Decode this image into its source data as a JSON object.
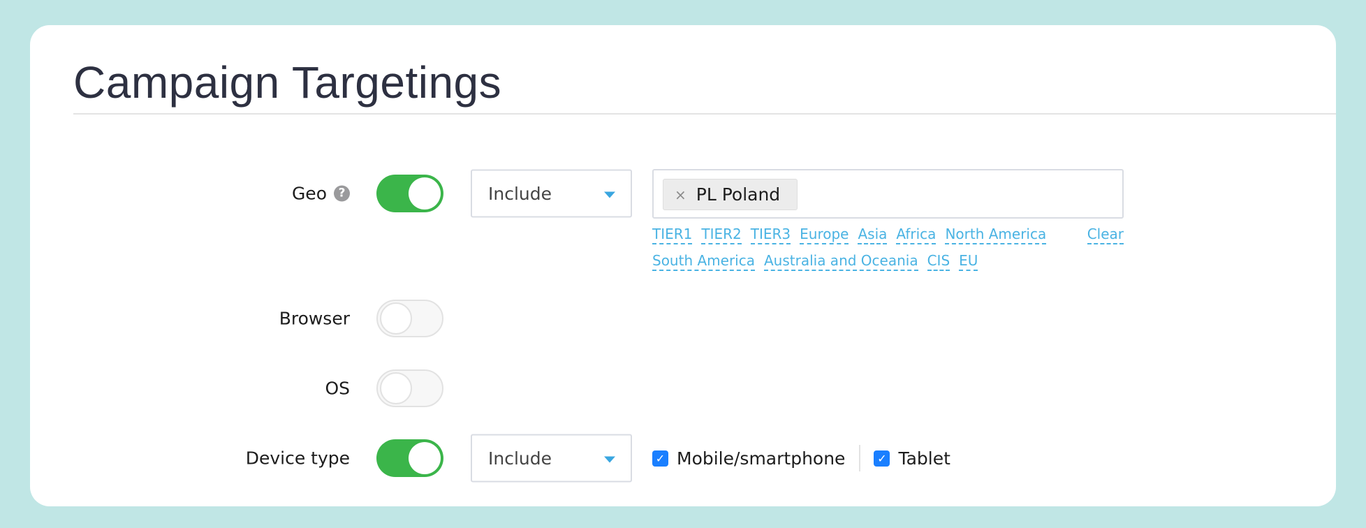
{
  "page": {
    "title": "Campaign Targetings"
  },
  "colors": {
    "page_bg": "#c0e6e5",
    "toggle_on": "#3bb54a",
    "link": "#4ab3e3",
    "checkbox": "#1a7fff"
  },
  "icons": {
    "help": "?",
    "remove": "×",
    "check": "✓"
  },
  "geo": {
    "label": "Geo",
    "enabled": true,
    "mode": "Include",
    "selected": [
      {
        "code": "PL",
        "name": "Poland",
        "label": "PL Poland"
      }
    ],
    "quick_links_row1": [
      "TIER1",
      "TIER2",
      "TIER3",
      "Europe",
      "Asia",
      "Africa",
      "North America"
    ],
    "quick_links_row2": [
      "South America",
      "Australia and Oceania",
      "CIS",
      "EU"
    ],
    "clear_label": "Clear"
  },
  "browser": {
    "label": "Browser",
    "enabled": false
  },
  "os": {
    "label": "OS",
    "enabled": false
  },
  "device_type": {
    "label": "Device type",
    "enabled": true,
    "mode": "Include",
    "options": [
      {
        "label": "Mobile/smartphone",
        "checked": true
      },
      {
        "label": "Tablet",
        "checked": true
      }
    ]
  }
}
